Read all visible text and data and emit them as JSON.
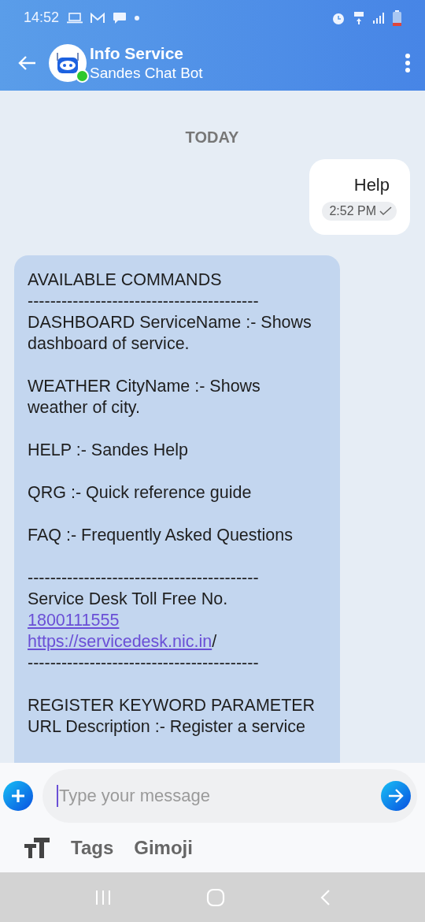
{
  "status_bar": {
    "time": "14:52"
  },
  "header": {
    "title": "Info Service",
    "subtitle": "Sandes Chat Bot",
    "online": true
  },
  "date_separator": "TODAY",
  "messages": [
    {
      "kind": "outgoing",
      "text": "Help",
      "time": "2:52 PM",
      "delivered": true
    },
    {
      "kind": "incoming",
      "lines": [
        {
          "kind": "text",
          "text": "AVAILABLE COMMANDS"
        },
        {
          "kind": "text",
          "text": "-----------------------------------------"
        },
        {
          "kind": "text",
          "text": "DASHBOARD ServiceName :- Shows dashboard of service."
        },
        {
          "kind": "gap"
        },
        {
          "kind": "text",
          "text": "WEATHER CityName :- Shows weather of city."
        },
        {
          "kind": "gap"
        },
        {
          "kind": "text",
          "text": "HELP :- Sandes Help"
        },
        {
          "kind": "gap"
        },
        {
          "kind": "text",
          "text": "QRG :- Quick reference guide"
        },
        {
          "kind": "gap"
        },
        {
          "kind": "text",
          "text": "FAQ :- Frequently Asked Questions"
        },
        {
          "kind": "gap"
        },
        {
          "kind": "text",
          "text": "-----------------------------------------"
        },
        {
          "kind": "text",
          "text": "Service Desk Toll Free No."
        },
        {
          "kind": "link",
          "text": "1800111555"
        },
        {
          "kind": "link",
          "text": "https://servicedesk.nic.in",
          "suffix": "/"
        },
        {
          "kind": "text",
          "text": "-----------------------------------------"
        },
        {
          "kind": "gap"
        },
        {
          "kind": "text",
          "text": "REGISTER KEYWORD PARAMETER URL Description :- Register a service"
        }
      ]
    }
  ],
  "composer": {
    "placeholder": "Type your message"
  },
  "toolbar": [
    "Tags",
    "Gimoji"
  ]
}
